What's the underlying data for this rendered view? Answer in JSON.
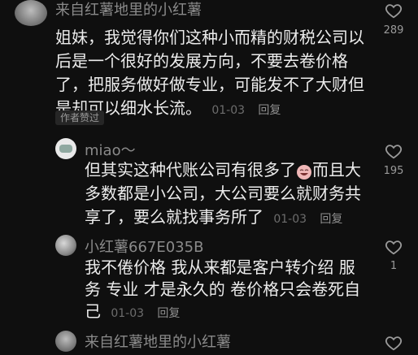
{
  "comments": [
    {
      "username": "来自红薯地里的小红薯",
      "text": "姐妹，我觉得你们这种小而精的财税公司以后是一个很好的发展方向，不要去卷价格了，把服务做好做专业，可能发不了大财但是却可以细水长流。",
      "date": "01-03",
      "reply_label": "回复",
      "badge": "作者赞过",
      "like_count": "289"
    },
    {
      "username": "miao～",
      "text": "但其实这种代账公司有很多了",
      "text_after_emoji": "而且大多数都是小公司，大公司要么就财务共享了，要么就找事务所了",
      "date": "01-03",
      "reply_label": "回复",
      "like_count": "195"
    },
    {
      "username": "小红薯667E035B",
      "text": "我不倦价格 我从来都是客户转介绍 服务 专业 才是永久的 卷价格只会卷死自己",
      "date": "01-03",
      "reply_label": "回复",
      "like_count": "1"
    },
    {
      "username": "来自红薯地里的小红薯"
    }
  ],
  "icons": {
    "like": "heart-outline-icon",
    "emoji": "laughing-face-emoji-icon"
  },
  "colors": {
    "background": "#0f0f0f",
    "text": "#ececec",
    "muted": "#8a8a8a"
  }
}
